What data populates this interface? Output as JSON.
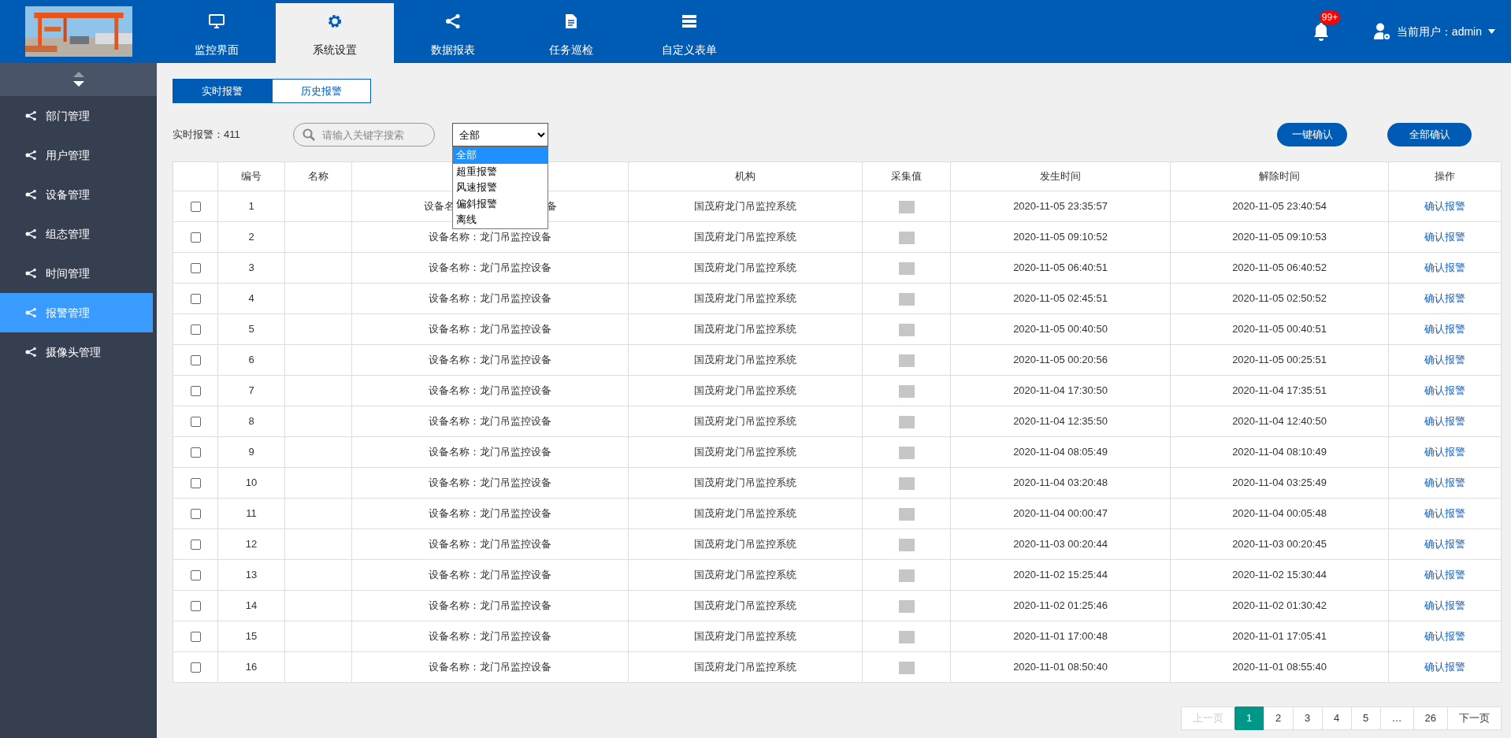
{
  "topnav": {
    "tabs": [
      {
        "label": "监控界面",
        "selected": false
      },
      {
        "label": "系统设置",
        "selected": true
      },
      {
        "label": "数据报表",
        "selected": false
      },
      {
        "label": "任务巡检",
        "selected": false
      },
      {
        "label": "自定义表单",
        "selected": false
      }
    ],
    "notifications": {
      "badge": "99+"
    },
    "user": {
      "label": "当前用户：admin"
    }
  },
  "sidebar": {
    "items": [
      {
        "label": "部门管理",
        "selected": false
      },
      {
        "label": "用户管理",
        "selected": false
      },
      {
        "label": "设备管理",
        "selected": false
      },
      {
        "label": "组态管理",
        "selected": false
      },
      {
        "label": "时间管理",
        "selected": false
      },
      {
        "label": "报警管理",
        "selected": true
      },
      {
        "label": "摄像头管理",
        "selected": false
      }
    ]
  },
  "subtabs": [
    {
      "label": "实时报警",
      "selected": true
    },
    {
      "label": "历史报警",
      "selected": false
    }
  ],
  "filter": {
    "count_label": "实时报警：411",
    "search": {
      "placeholder": "请输入关键字搜索"
    },
    "type_select": {
      "value": "全部",
      "expanded": true,
      "options": [
        {
          "label": "全部",
          "selected": true
        },
        {
          "label": "超重报警",
          "selected": false
        },
        {
          "label": "风速报警",
          "selected": false
        },
        {
          "label": "偏斜报警",
          "selected": false
        },
        {
          "label": "离线",
          "selected": false
        }
      ]
    },
    "buttons": [
      "一键确认",
      "全部确认"
    ]
  },
  "table": {
    "columns": [
      "",
      "编号",
      "名称",
      "",
      "机构",
      "采集值",
      "发生时间",
      "解除时间",
      "操作"
    ],
    "rows": [
      {
        "checked": false,
        "id": "1",
        "device": [
          "设备名",
          "备"
        ],
        "org": "国茂府龙门吊监控系统",
        "occurred": "2020-11-05 23:35:57",
        "cleared": "2020-11-05 23:40:54",
        "action": "确认报警"
      },
      {
        "checked": false,
        "id": "2",
        "device": "设备名称：龙门吊监控设备",
        "org": "国茂府龙门吊监控系统",
        "occurred": "2020-11-05 09:10:52",
        "cleared": "2020-11-05 09:10:53",
        "action": "确认报警"
      },
      {
        "checked": false,
        "id": "3",
        "device": "设备名称：龙门吊监控设备",
        "org": "国茂府龙门吊监控系统",
        "occurred": "2020-11-05 06:40:51",
        "cleared": "2020-11-05 06:40:52",
        "action": "确认报警"
      },
      {
        "checked": false,
        "id": "4",
        "device": "设备名称：龙门吊监控设备",
        "org": "国茂府龙门吊监控系统",
        "occurred": "2020-11-05 02:45:51",
        "cleared": "2020-11-05 02:50:52",
        "action": "确认报警"
      },
      {
        "checked": false,
        "id": "5",
        "device": "设备名称：龙门吊监控设备",
        "org": "国茂府龙门吊监控系统",
        "occurred": "2020-11-05 00:40:50",
        "cleared": "2020-11-05 00:40:51",
        "action": "确认报警"
      },
      {
        "checked": false,
        "id": "6",
        "device": "设备名称：龙门吊监控设备",
        "org": "国茂府龙门吊监控系统",
        "occurred": "2020-11-05 00:20:56",
        "cleared": "2020-11-05 00:25:51",
        "action": "确认报警"
      },
      {
        "checked": false,
        "id": "7",
        "device": "设备名称：龙门吊监控设备",
        "org": "国茂府龙门吊监控系统",
        "occurred": "2020-11-04 17:30:50",
        "cleared": "2020-11-04 17:35:51",
        "action": "确认报警"
      },
      {
        "checked": false,
        "id": "8",
        "device": "设备名称：龙门吊监控设备",
        "org": "国茂府龙门吊监控系统",
        "occurred": "2020-11-04 12:35:50",
        "cleared": "2020-11-04 12:40:50",
        "action": "确认报警"
      },
      {
        "checked": false,
        "id": "9",
        "device": "设备名称：龙门吊监控设备",
        "org": "国茂府龙门吊监控系统",
        "occurred": "2020-11-04 08:05:49",
        "cleared": "2020-11-04 08:10:49",
        "action": "确认报警"
      },
      {
        "checked": false,
        "id": "10",
        "device": "设备名称：龙门吊监控设备",
        "org": "国茂府龙门吊监控系统",
        "occurred": "2020-11-04 03:20:48",
        "cleared": "2020-11-04 03:25:49",
        "action": "确认报警"
      },
      {
        "checked": false,
        "id": "11",
        "device": "设备名称：龙门吊监控设备",
        "org": "国茂府龙门吊监控系统",
        "occurred": "2020-11-04 00:00:47",
        "cleared": "2020-11-04 00:05:48",
        "action": "确认报警"
      },
      {
        "checked": false,
        "id": "12",
        "device": "设备名称：龙门吊监控设备",
        "org": "国茂府龙门吊监控系统",
        "occurred": "2020-11-03 00:20:44",
        "cleared": "2020-11-03 00:20:45",
        "action": "确认报警"
      },
      {
        "checked": false,
        "id": "13",
        "device": "设备名称：龙门吊监控设备",
        "org": "国茂府龙门吊监控系统",
        "occurred": "2020-11-02 15:25:44",
        "cleared": "2020-11-02 15:30:44",
        "action": "确认报警"
      },
      {
        "checked": false,
        "id": "14",
        "device": "设备名称：龙门吊监控设备",
        "org": "国茂府龙门吊监控系统",
        "occurred": "2020-11-02 01:25:46",
        "cleared": "2020-11-02 01:30:42",
        "action": "确认报警"
      },
      {
        "checked": false,
        "id": "15",
        "device": "设备名称：龙门吊监控设备",
        "org": "国茂府龙门吊监控系统",
        "occurred": "2020-11-01 17:00:48",
        "cleared": "2020-11-01 17:05:41",
        "action": "确认报警"
      },
      {
        "checked": false,
        "id": "16",
        "device": "设备名称：龙门吊监控设备",
        "org": "国茂府龙门吊监控系统",
        "occurred": "2020-11-01 08:50:40",
        "cleared": "2020-11-01 08:55:40",
        "action": "确认报警"
      }
    ]
  },
  "pagination": {
    "items": [
      {
        "label": "上一页",
        "selected": false,
        "disabled": true
      },
      {
        "label": "1",
        "selected": true,
        "disabled": false
      },
      {
        "label": "2",
        "selected": false,
        "disabled": false
      },
      {
        "label": "3",
        "selected": false,
        "disabled": false
      },
      {
        "label": "4",
        "selected": false,
        "disabled": false
      },
      {
        "label": "5",
        "selected": false,
        "disabled": false
      },
      {
        "label": "…",
        "selected": false,
        "disabled": false
      },
      {
        "label": "26",
        "selected": false,
        "disabled": false
      },
      {
        "label": "下一页",
        "selected": false,
        "disabled": false
      }
    ]
  }
}
